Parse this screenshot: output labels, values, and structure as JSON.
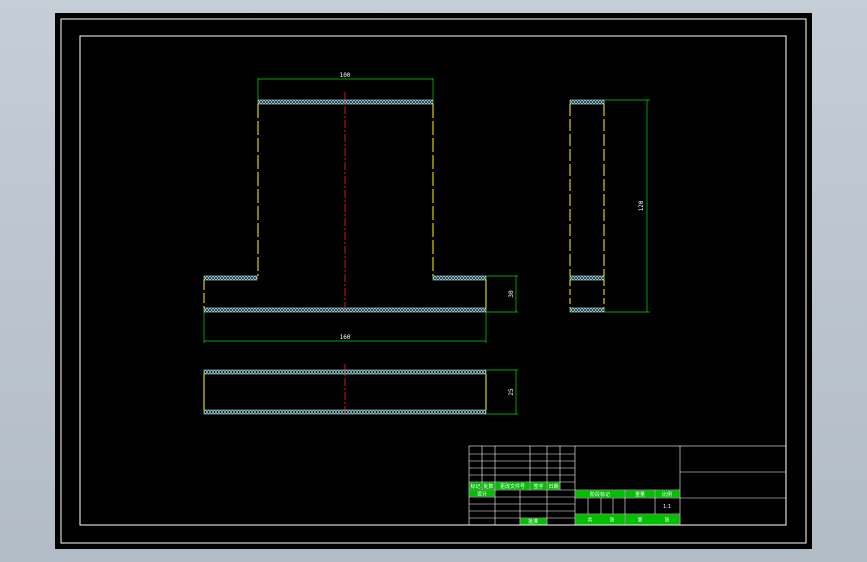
{
  "colors": {
    "background": "#b9c2cc",
    "paper": "#000000",
    "border": "#ffffff",
    "outline": "#ffff00",
    "hatch": "#7fd3e0",
    "centerline": "#ff2020",
    "dimension": "#00e000",
    "table_lines": "#ffffff",
    "table_fill": "#00d000"
  },
  "dimensions": {
    "top_width": "100",
    "flange_height": "30",
    "base_width": "160",
    "side_height": "120",
    "plate_height": "25"
  },
  "title_block": {
    "rev_headers": [
      "标记",
      "处数",
      "更改文件号",
      "签字",
      "日期"
    ],
    "row_design": "设计",
    "stage_headers": [
      "阶段标记",
      "重量",
      "比例"
    ],
    "scale": "1:1",
    "approve": "批准",
    "total": "共",
    "sheets": "张",
    "sheet_no": "第",
    "sheet_unit": "张"
  }
}
